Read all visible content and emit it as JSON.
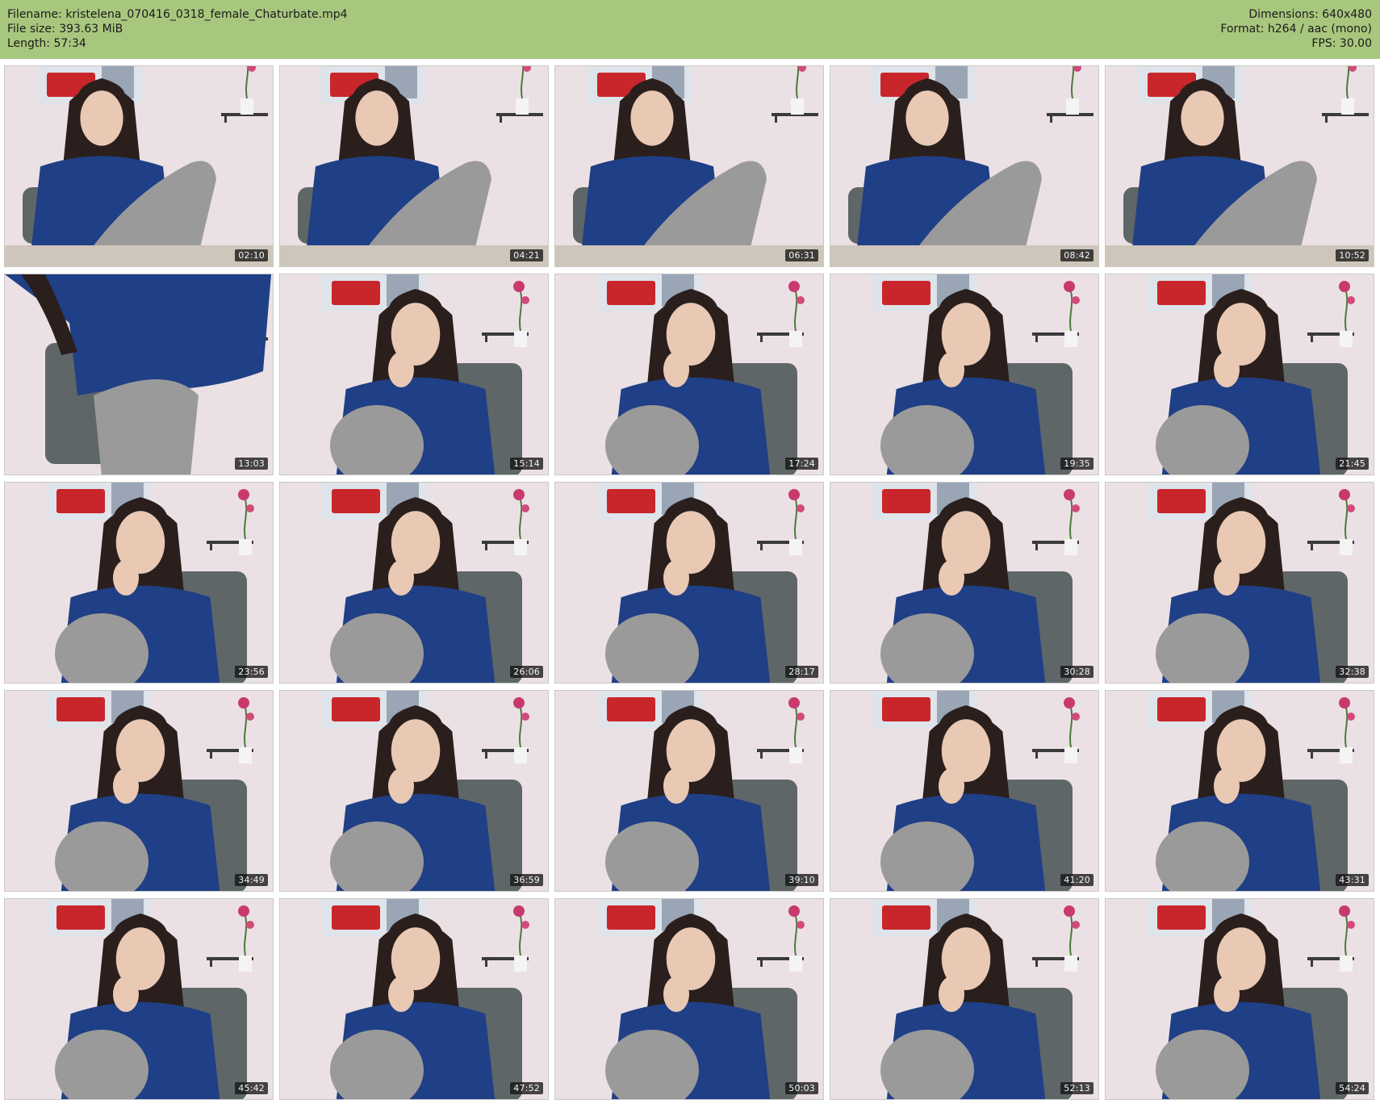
{
  "header": {
    "filename_label": "Filename:",
    "filename": "kristelena_070416_0318_female_Chaturbate.mp4",
    "filesize_label": "File size:",
    "filesize": "393.63 MiB",
    "length_label": "Length:",
    "length": "57:34",
    "dimensions_label": "Dimensions:",
    "dimensions": "640x480",
    "format_label": "Format:",
    "format": "h264 / aac (mono)",
    "fps_label": "FPS:",
    "fps": "30.00"
  },
  "colors": {
    "header_bg": "#a8c77e",
    "wall": "#ebe1e4",
    "sweater": "#1f3f86",
    "leggings": "#9a9a9a",
    "hair": "#2a1f1c",
    "skin": "#e9c8b4",
    "chair": "#5f6668"
  },
  "thumbnails": [
    {
      "time": "02:10",
      "scene": "desk"
    },
    {
      "time": "04:21",
      "scene": "desk"
    },
    {
      "time": "06:31",
      "scene": "desk"
    },
    {
      "time": "08:42",
      "scene": "desk"
    },
    {
      "time": "10:52",
      "scene": "desk"
    },
    {
      "time": "13:03",
      "scene": "away"
    },
    {
      "time": "15:14",
      "scene": "close"
    },
    {
      "time": "17:24",
      "scene": "close"
    },
    {
      "time": "19:35",
      "scene": "close"
    },
    {
      "time": "21:45",
      "scene": "close"
    },
    {
      "time": "23:56",
      "scene": "close"
    },
    {
      "time": "26:06",
      "scene": "close"
    },
    {
      "time": "28:17",
      "scene": "close"
    },
    {
      "time": "30:28",
      "scene": "close"
    },
    {
      "time": "32:38",
      "scene": "close"
    },
    {
      "time": "34:49",
      "scene": "close"
    },
    {
      "time": "36:59",
      "scene": "close"
    },
    {
      "time": "39:10",
      "scene": "close"
    },
    {
      "time": "41:20",
      "scene": "close"
    },
    {
      "time": "43:31",
      "scene": "close"
    },
    {
      "time": "45:42",
      "scene": "close"
    },
    {
      "time": "47:52",
      "scene": "close"
    },
    {
      "time": "50:03",
      "scene": "close"
    },
    {
      "time": "52:13",
      "scene": "close"
    },
    {
      "time": "54:24",
      "scene": "close"
    }
  ]
}
